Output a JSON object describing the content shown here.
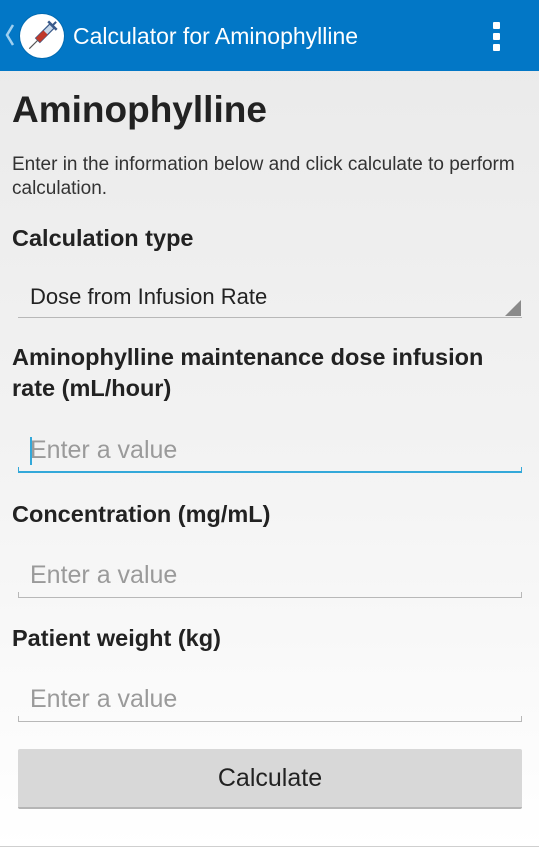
{
  "app_bar": {
    "title": "Calculator for Aminophylline",
    "up_icon": "chevron-left-icon",
    "app_icon": "syringe-icon",
    "menu_icon": "overflow-menu-icon",
    "background_color": "#0277c6"
  },
  "page": {
    "title": "Aminophylline",
    "intro": "Enter in the information below and click calculate to perform calculation."
  },
  "calculation_type": {
    "label": "Calculation type",
    "selected": "Dose from Infusion Rate"
  },
  "fields": [
    {
      "label": "Aminophylline maintenance dose infusion rate (mL/hour)",
      "placeholder": "Enter a value",
      "value": "",
      "focused": true
    },
    {
      "label": "Concentration (mg/mL)",
      "placeholder": "Enter a value",
      "value": "",
      "focused": false
    },
    {
      "label": "Patient weight (kg)",
      "placeholder": "Enter a value",
      "value": "",
      "focused": false
    }
  ],
  "calculate_button": {
    "label": "Calculate"
  },
  "colors": {
    "accent": "#33a8d9",
    "button": "#d8d8d8"
  }
}
